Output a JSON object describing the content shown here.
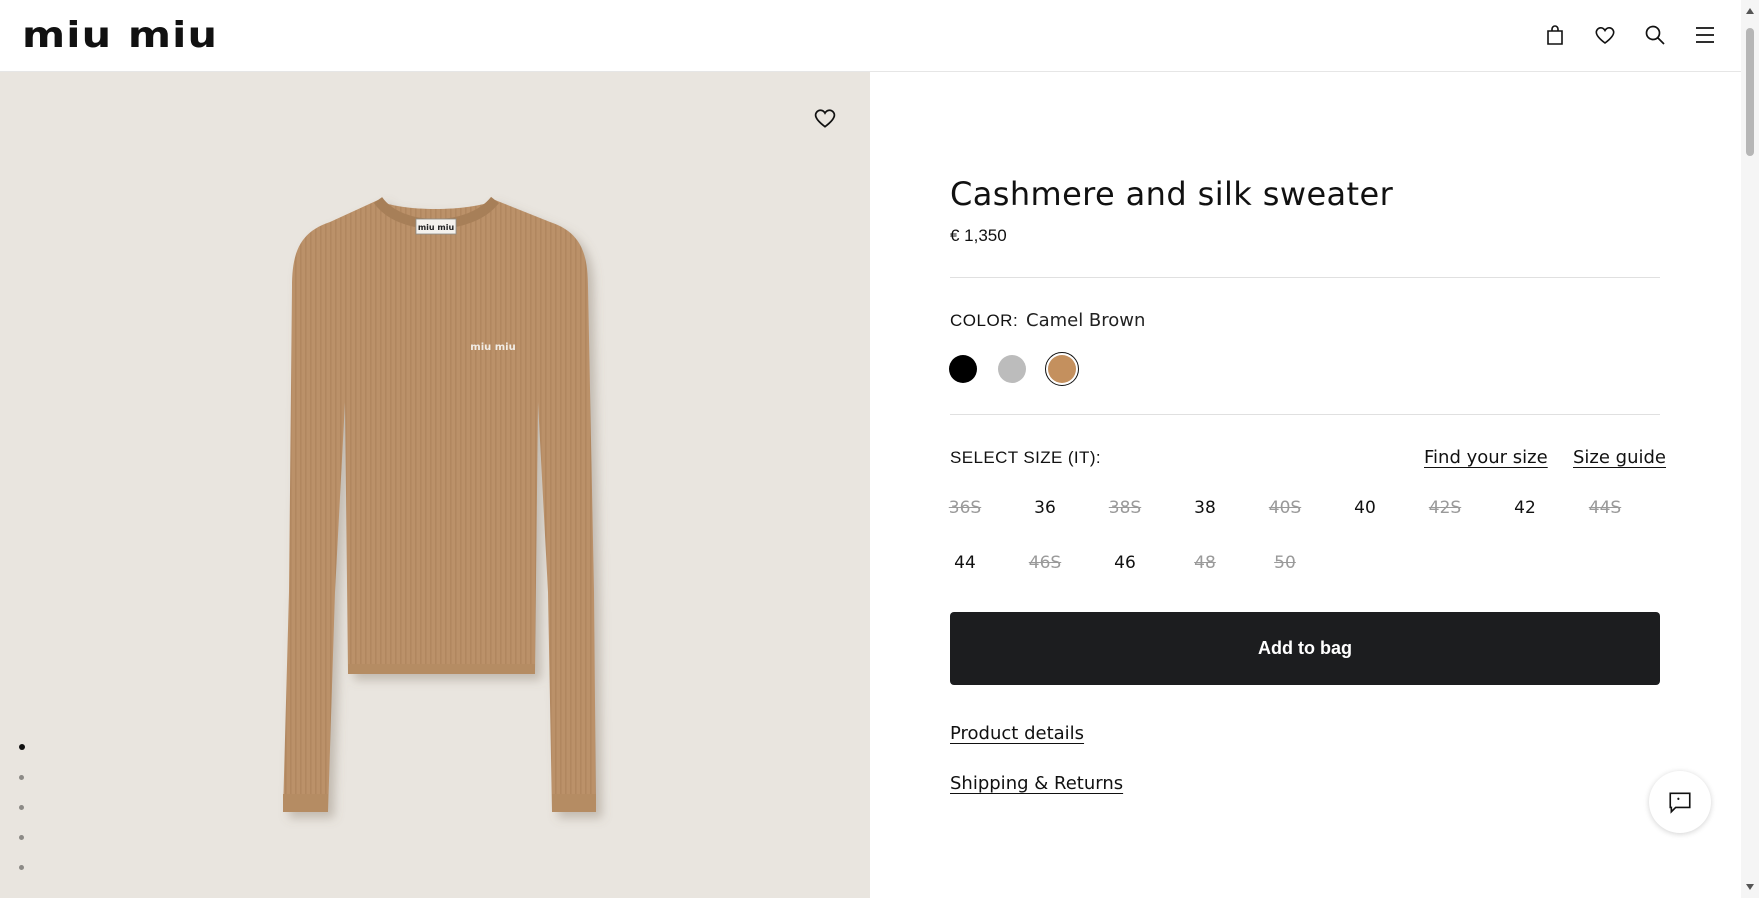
{
  "header": {
    "logo": "miu miu",
    "icons": [
      "bag-icon",
      "heart-icon",
      "search-icon",
      "menu-icon"
    ]
  },
  "gallery": {
    "label_text": "miu miu",
    "chest_text": "miu miu",
    "slides_count": 5,
    "active_slide": 1
  },
  "product": {
    "title": "Cashmere and silk sweater",
    "price": "€ 1,350",
    "color_label": "COLOR:",
    "color_value": "Camel Brown",
    "swatches": [
      {
        "name": "Black",
        "hex": "#000000"
      },
      {
        "name": "Grey",
        "hex": "#bcbcbc"
      },
      {
        "name": "Camel Brown",
        "hex": "#c4905e"
      }
    ],
    "size_label": "SELECT SIZE (IT):",
    "find_size": "Find your size",
    "size_guide": "Size guide",
    "sizes_row1": [
      "36S",
      "36",
      "38S",
      "38",
      "40S",
      "40",
      "42S",
      "42",
      "44S"
    ],
    "sizes_row2": [
      "44",
      "46S",
      "46",
      "48",
      "50"
    ],
    "add_to_bag": "Add to bag",
    "product_details": "Product details",
    "shipping_returns": "Shipping & Returns"
  },
  "colors": {
    "garment": "#bb9169",
    "background": "#e9e5df",
    "button": "#1c1d1f"
  }
}
